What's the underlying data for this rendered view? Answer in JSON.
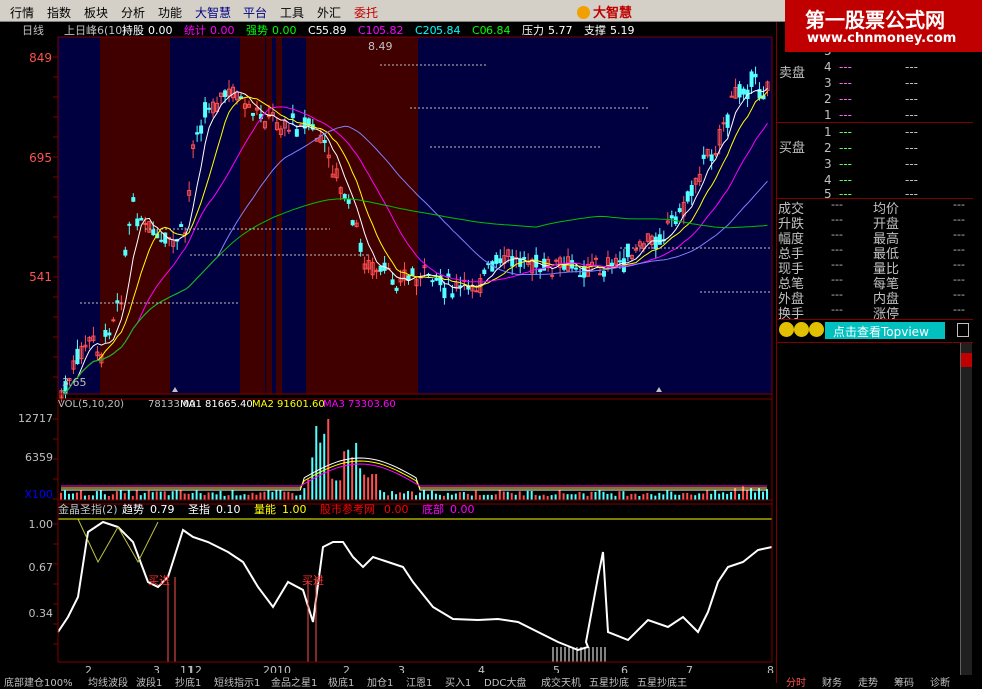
{
  "menu": [
    "行情",
    "指数",
    "板块",
    "分析",
    "功能",
    "大智慧",
    "平台",
    "工具",
    "外汇",
    "委托"
  ],
  "logo": "大智慧",
  "watermark": {
    "line1": "第一股票公式网",
    "line2": "www.chnmoney.com"
  },
  "period": "日线",
  "main_header": {
    "name": "上日峰6(10)",
    "items": [
      {
        "label": "持股",
        "value": "0.00",
        "color": "#ffffff"
      },
      {
        "label": "统计",
        "value": "0.00",
        "color": "#ff00ff"
      },
      {
        "label": "强势",
        "value": "0.00",
        "color": "#00ff00"
      },
      {
        "label": "C5",
        "value": "5.89",
        "color": "#ffffff"
      },
      {
        "label": "C10",
        "value": "5.82",
        "color": "#ff00ff"
      },
      {
        "label": "C20",
        "value": "5.84",
        "color": "#00ffff"
      },
      {
        "label": "C0",
        "value": "6.84",
        "color": "#00ff00"
      },
      {
        "label": "压力",
        "value": "5.77",
        "color": "#ffffff"
      },
      {
        "label": "支撑",
        "value": "5.19",
        "color": "#ffffff"
      }
    ]
  },
  "price_axis": [
    "849",
    "695",
    "541"
  ],
  "price_marks": {
    "high": "8.49",
    "low": "3.65"
  },
  "vol_header": {
    "name": "VOL(5,10,20)",
    "value": "78133.00",
    "ma1": "MA1 81665.40",
    "ma2": "MA2 91601.60",
    "ma3": "MA3 73303.60"
  },
  "vol_axis": [
    "12717",
    "6359",
    "X100"
  ],
  "ind_header": {
    "name": "金晶圣指(2)",
    "items": [
      {
        "label": "趋势",
        "value": "0.79",
        "color": "#ffffff"
      },
      {
        "label": "圣指",
        "value": "0.10",
        "color": "#ffffff"
      },
      {
        "label": "量能",
        "value": "1.00",
        "color": "#ffff00"
      },
      {
        "label": "股市参考网",
        "value": "0.00",
        "color": "#ff0000"
      },
      {
        "label": "底部",
        "value": "0.00",
        "color": "#ff00ff"
      }
    ]
  },
  "ind_axis": [
    "1.00",
    "0.67",
    "0.34"
  ],
  "signals": [
    "买进",
    "买进"
  ],
  "date_axis": [
    "2",
    "3",
    "11",
    "12",
    "2010",
    "2",
    "3",
    "4",
    "5",
    "6",
    "7",
    "8"
  ],
  "bottom_tabs": [
    "底部建仓100%",
    "均线波段",
    "波段1",
    "抄底1",
    "短线指示1",
    "金品之星1",
    "极底1",
    "加仓1",
    "江恩1",
    "买入1",
    "DDC大盘",
    "成交天机",
    "五星抄底",
    "五星抄底王"
  ],
  "right_tabs": [
    "分时",
    "财务",
    "走势",
    "筹码",
    "诊断"
  ],
  "sell": {
    "label": "卖盘",
    "rows": [
      "5",
      "4",
      "3",
      "2",
      "1"
    ]
  },
  "buy": {
    "label": "买盘",
    "rows": [
      "1",
      "2",
      "3",
      "4",
      "5"
    ]
  },
  "stats": [
    [
      "成交",
      "---",
      "均价",
      "---"
    ],
    [
      "升跌",
      "---",
      "开盘",
      "---"
    ],
    [
      "幅度",
      "---",
      "最高",
      "---"
    ],
    [
      "总手",
      "---",
      "最低",
      "---"
    ],
    [
      "现手",
      "---",
      "量比",
      "---"
    ],
    [
      "总笔",
      "---",
      "每笔",
      "---"
    ],
    [
      "外盘",
      "---",
      "内盘",
      "---"
    ],
    [
      "换手",
      "---",
      "涨停",
      "---"
    ]
  ],
  "topview": "点击查看Topview",
  "colors": {
    "up": "#ff5050",
    "down": "#54ffff",
    "panel_line": "#800000"
  }
}
